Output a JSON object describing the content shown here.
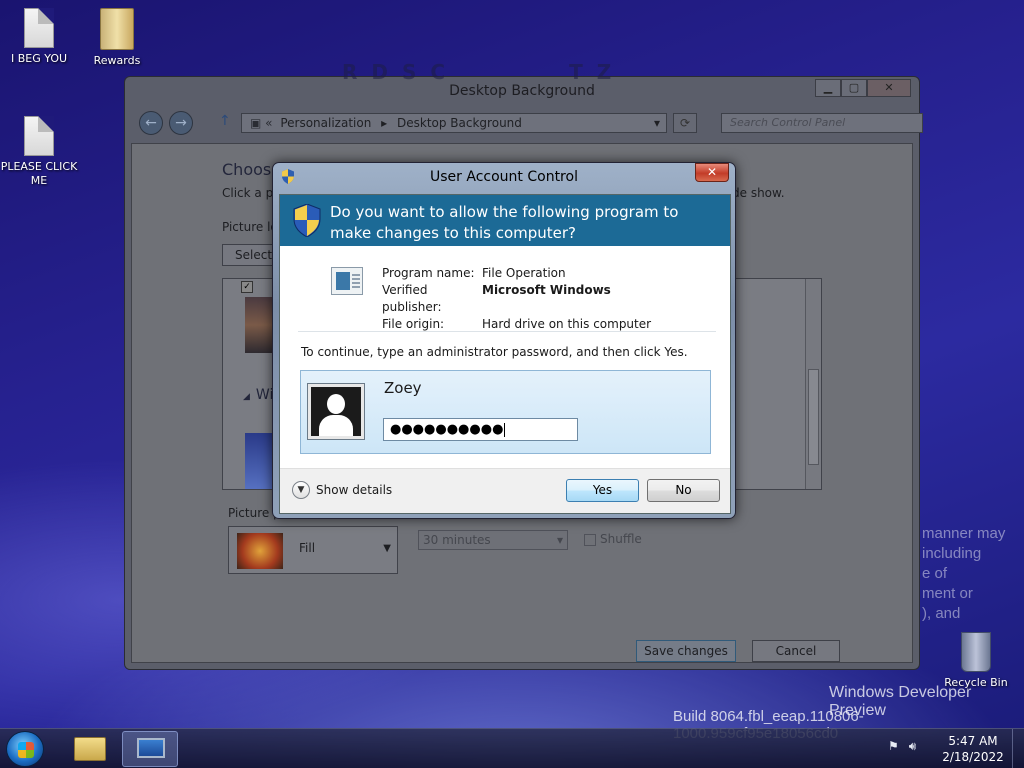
{
  "desktop": {
    "icons": [
      {
        "label": "I BEG YOU",
        "icon": "document-icon"
      },
      {
        "label": "Rewards",
        "icon": "folder-icon"
      },
      {
        "label": "PLEASE CLICK ME",
        "icon": "document-icon"
      }
    ],
    "recycle_bin": "Recycle Bin",
    "watermark": {
      "line1": "Windows Developer Preview",
      "line2": "Build 8064.fbl_eeap.110806-1000.959cf95e18056cd0"
    },
    "side_text": [
      "manner may",
      "including",
      "e of",
      "ment or",
      "), and"
    ]
  },
  "explorer": {
    "title": "Desktop Background",
    "breadcrumbs": [
      "Personalization",
      "Desktop Background"
    ],
    "search_placeholder": "Search Control Panel",
    "heading": "Choose",
    "subtitle": "Click a p",
    "subtitle_tail": "de show.",
    "picture_location_label": "Picture lo",
    "select_button": "Select",
    "group_label": "Win",
    "picture_position_label": "Picture p",
    "position_value": "Fill",
    "interval_value": "30 minutes",
    "shuffle_label": "Shuffle",
    "save_button": "Save changes",
    "cancel_button": "Cancel",
    "faded_letters": [
      "R",
      "D",
      "S",
      "C",
      "T",
      "Z"
    ]
  },
  "uac": {
    "title": "User Account Control",
    "question": "Do you want to allow the following program to make changes to this computer?",
    "program_name_label": "Program name:",
    "program_name": "File Operation",
    "publisher_label": "Verified publisher:",
    "publisher": "Microsoft Windows",
    "origin_label": "File origin:",
    "origin": "Hard drive on this computer",
    "continue_text": "To continue, type an administrator password, and then click Yes.",
    "username": "Zoey",
    "password_mask": "●●●●●●●●●●",
    "show_details": "Show details",
    "yes_button": "Yes",
    "no_button": "No",
    "close_glyph": "✕"
  },
  "taskbar": {
    "time": "5:47 AM",
    "date": "2/18/2022"
  },
  "colors": {
    "uac_header": "#1c6a96",
    "desktop_bg": "#26218f"
  }
}
